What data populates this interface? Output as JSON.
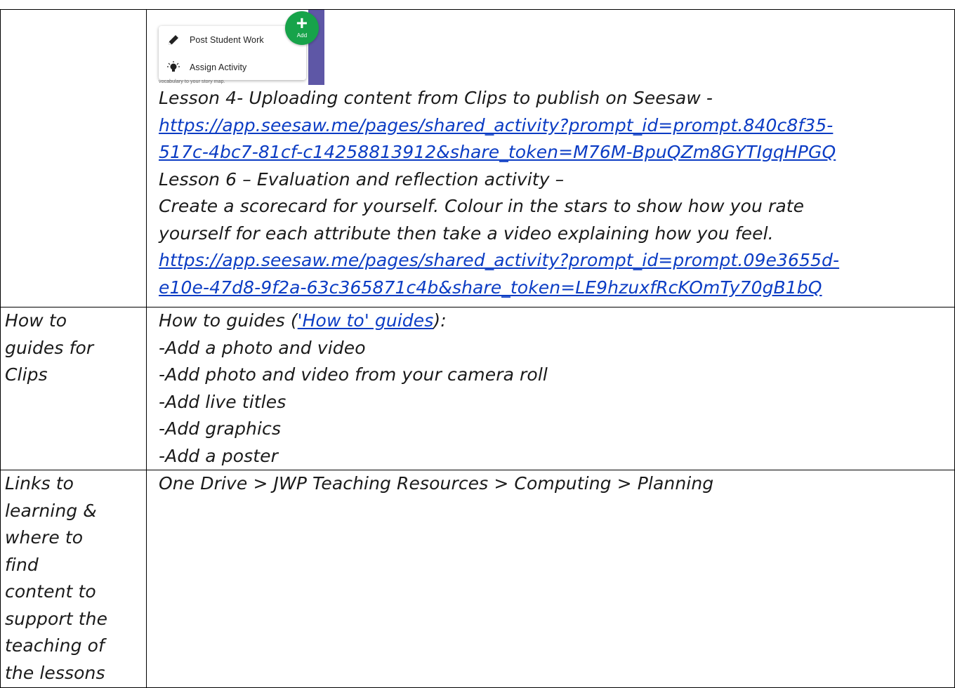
{
  "screenshot": {
    "menu_items": [
      {
        "label": "Post Student Work",
        "icon": "pencil-icon"
      },
      {
        "label": "Assign Activity",
        "icon": "lightbulb-icon"
      }
    ],
    "add_button_label": "Add",
    "under_text": "vocabulary to your story map.",
    "colors": {
      "purple": "#5e57a6",
      "green": "#17a34a"
    }
  },
  "row1": {
    "lesson4_title": "Lesson 4- Uploading content from Clips to publish on Seesaw -",
    "lesson4_link_line1": "https://app.seesaw.me/pages/shared_activity?prompt_id=prompt.840c8f35-",
    "lesson4_link_line2": "517c-4bc7-81cf-c14258813912&share_token=M76M-BpuQZm8GYTIgqHPGQ",
    "lesson6_title": "Lesson 6 – Evaluation and reflection activity –",
    "lesson6_desc_line1": "Create a scorecard for yourself. Colour in the stars to show how you rate",
    "lesson6_desc_line2": "yourself for each attribute then take a video explaining how you feel.",
    "lesson6_link_line1": "https://app.seesaw.me/pages/shared_activity?prompt_id=prompt.09e3655d-",
    "lesson6_link_line2": "e10e-47d8-9f2a-63c365871c4b&share_token=LE9hzuxfRcKOmTy70gB1bQ"
  },
  "row2": {
    "left_lines": [
      "How to",
      "guides for",
      "Clips"
    ],
    "intro_prefix": "How to guides (",
    "intro_link": "'How to' guides",
    "intro_suffix": "):",
    "items": [
      "-Add a photo and video",
      "-Add photo and video from your camera roll",
      "-Add live titles",
      "-Add graphics",
      "-Add a poster"
    ]
  },
  "row3": {
    "left_lines": [
      "Links to",
      "learning &",
      "where to",
      "find",
      "content to",
      "support the",
      "teaching of",
      "the lessons"
    ],
    "path": "One Drive > JWP Teaching Resources > Computing > Planning"
  }
}
